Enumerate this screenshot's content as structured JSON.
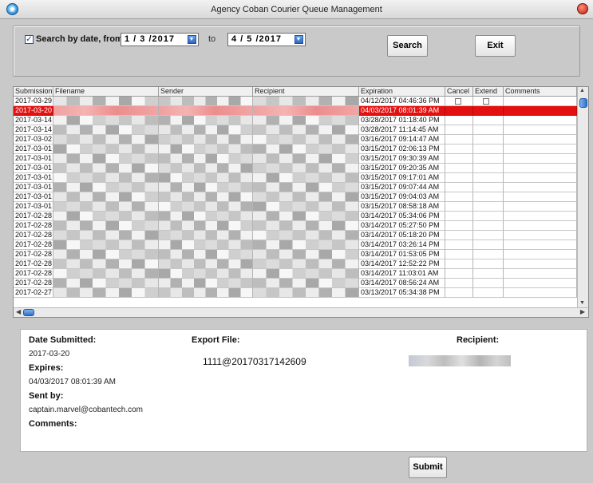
{
  "window": {
    "title": "Agency Coban Courier Queue Management"
  },
  "filter": {
    "checkbox_label": "Search by date, from",
    "checked": true,
    "from_date": "1 / 3 /2017",
    "to_label": "to",
    "to_date": "4 / 5 /2017",
    "search_label": "Search",
    "exit_label": "Exit"
  },
  "grid": {
    "columns": [
      "Submission",
      "Filename",
      "Sender",
      "Recipient",
      "Expiration",
      "Cancel",
      "Extend",
      "Comments"
    ],
    "rows": [
      {
        "submission": "2017-03-29",
        "expiration": "04/12/2017 04:46:36 PM"
      },
      {
        "submission": "2017-03-20",
        "expiration": "04/03/2017 08:01:39 AM",
        "selected": true
      },
      {
        "submission": "2017-03-14",
        "expiration": "03/28/2017 01:18:40 PM"
      },
      {
        "submission": "2017-03-14",
        "expiration": "03/28/2017 11:14:45 AM"
      },
      {
        "submission": "2017-03-02",
        "expiration": "03/16/2017 09:14:47 AM"
      },
      {
        "submission": "2017-03-01",
        "expiration": "03/15/2017 02:06:13 PM"
      },
      {
        "submission": "2017-03-01",
        "expiration": "03/15/2017 09:30:39 AM"
      },
      {
        "submission": "2017-03-01",
        "expiration": "03/15/2017 09:20:35 AM"
      },
      {
        "submission": "2017-03-01",
        "expiration": "03/15/2017 09:17:01 AM"
      },
      {
        "submission": "2017-03-01",
        "expiration": "03/15/2017 09:07:44 AM"
      },
      {
        "submission": "2017-03-01",
        "expiration": "03/15/2017 09:04:03 AM"
      },
      {
        "submission": "2017-03-01",
        "expiration": "03/15/2017 08:58:18 AM"
      },
      {
        "submission": "2017-02-28",
        "expiration": "03/14/2017 05:34:06 PM"
      },
      {
        "submission": "2017-02-28",
        "expiration": "03/14/2017 05:27:50 PM"
      },
      {
        "submission": "2017-02-28",
        "expiration": "03/14/2017 05:18:20 PM"
      },
      {
        "submission": "2017-02-28",
        "expiration": "03/14/2017 03:26:14 PM"
      },
      {
        "submission": "2017-02-28",
        "expiration": "03/14/2017 01:53:05 PM"
      },
      {
        "submission": "2017-02-28",
        "expiration": "03/14/2017 12:52:22 PM"
      },
      {
        "submission": "2017-02-28",
        "expiration": "03/14/2017 11:03:01 AM"
      },
      {
        "submission": "2017-02-28",
        "expiration": "03/14/2017 08:56:24 AM"
      },
      {
        "submission": "2017-02-27",
        "expiration": "03/13/2017 05:34:38 PM"
      }
    ]
  },
  "detail": {
    "date_submitted_label": "Date Submitted:",
    "date_submitted": "2017-03-20",
    "expires_label": "Expires:",
    "expires": "04/03/2017 08:01:39 AM",
    "sent_by_label": "Sent by:",
    "sent_by": "captain.marvel@cobantech.com",
    "comments_label": "Comments:",
    "export_file_label": "Export File:",
    "export_file": "1111@20170317142609",
    "recipient_label": "Recipient:"
  },
  "footer": {
    "submit_label": "Submit"
  },
  "colors": {
    "selected_row": "#e31010",
    "window_bg": "#c9c9c9",
    "scroll_accent": "#2f6fcf"
  }
}
